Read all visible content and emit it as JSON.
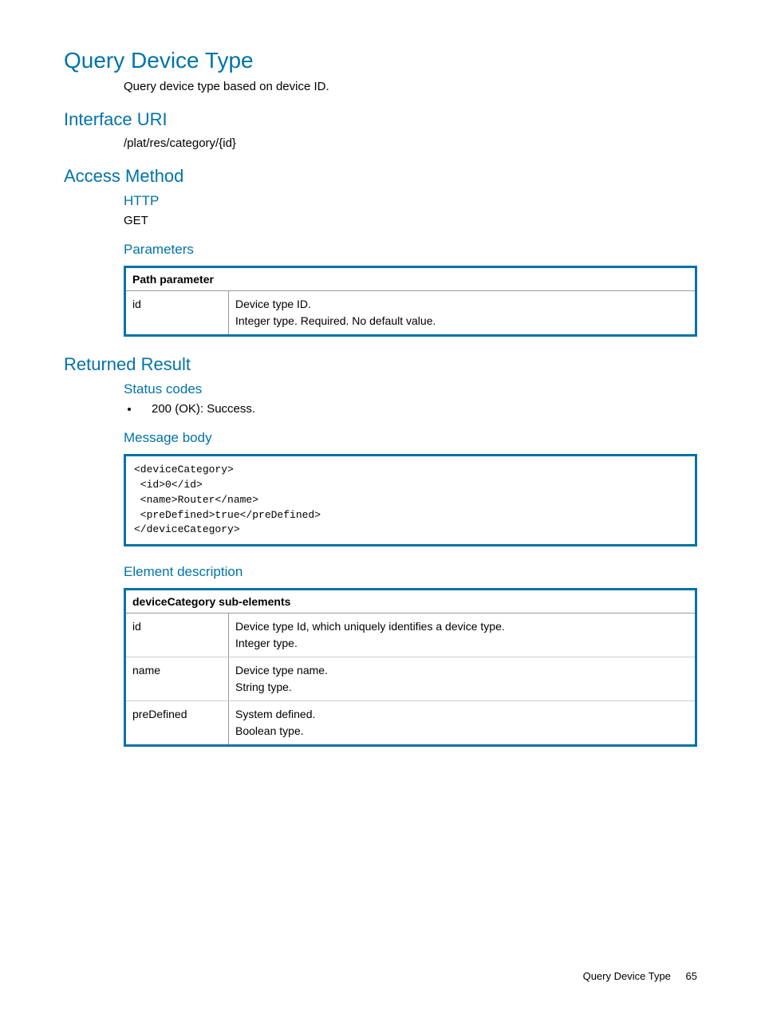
{
  "title": "Query Device Type",
  "intro": "Query device type based on device ID.",
  "sections": {
    "interfaceUri": {
      "heading": "Interface URI",
      "value": "/plat/res/category/{id}"
    },
    "accessMethod": {
      "heading": "Access Method",
      "http": {
        "heading": "HTTP",
        "method": "GET"
      },
      "parameters": {
        "heading": "Parameters",
        "tableHeader": "Path parameter",
        "rows": [
          {
            "name": "id",
            "desc1": "Device type ID.",
            "desc2": "Integer type. Required. No default value."
          }
        ]
      }
    },
    "returnedResult": {
      "heading": "Returned Result",
      "statusCodes": {
        "heading": "Status codes",
        "items": [
          "200 (OK): Success."
        ]
      },
      "messageBody": {
        "heading": "Message body",
        "code": "<deviceCategory>\n <id>0</id>\n <name>Router</name>\n <preDefined>true</preDefined>\n</deviceCategory>"
      },
      "elementDescription": {
        "heading": "Element description",
        "tableHeader": "deviceCategory sub-elements",
        "rows": [
          {
            "name": "id",
            "desc1": "Device type Id, which uniquely identifies a device type.",
            "desc2": "Integer type."
          },
          {
            "name": "name",
            "desc1": "Device type name.",
            "desc2": "String type."
          },
          {
            "name": "preDefined",
            "desc1": "System defined.",
            "desc2": "Boolean type."
          }
        ]
      }
    }
  },
  "footer": {
    "label": "Query Device Type",
    "page": "65"
  }
}
